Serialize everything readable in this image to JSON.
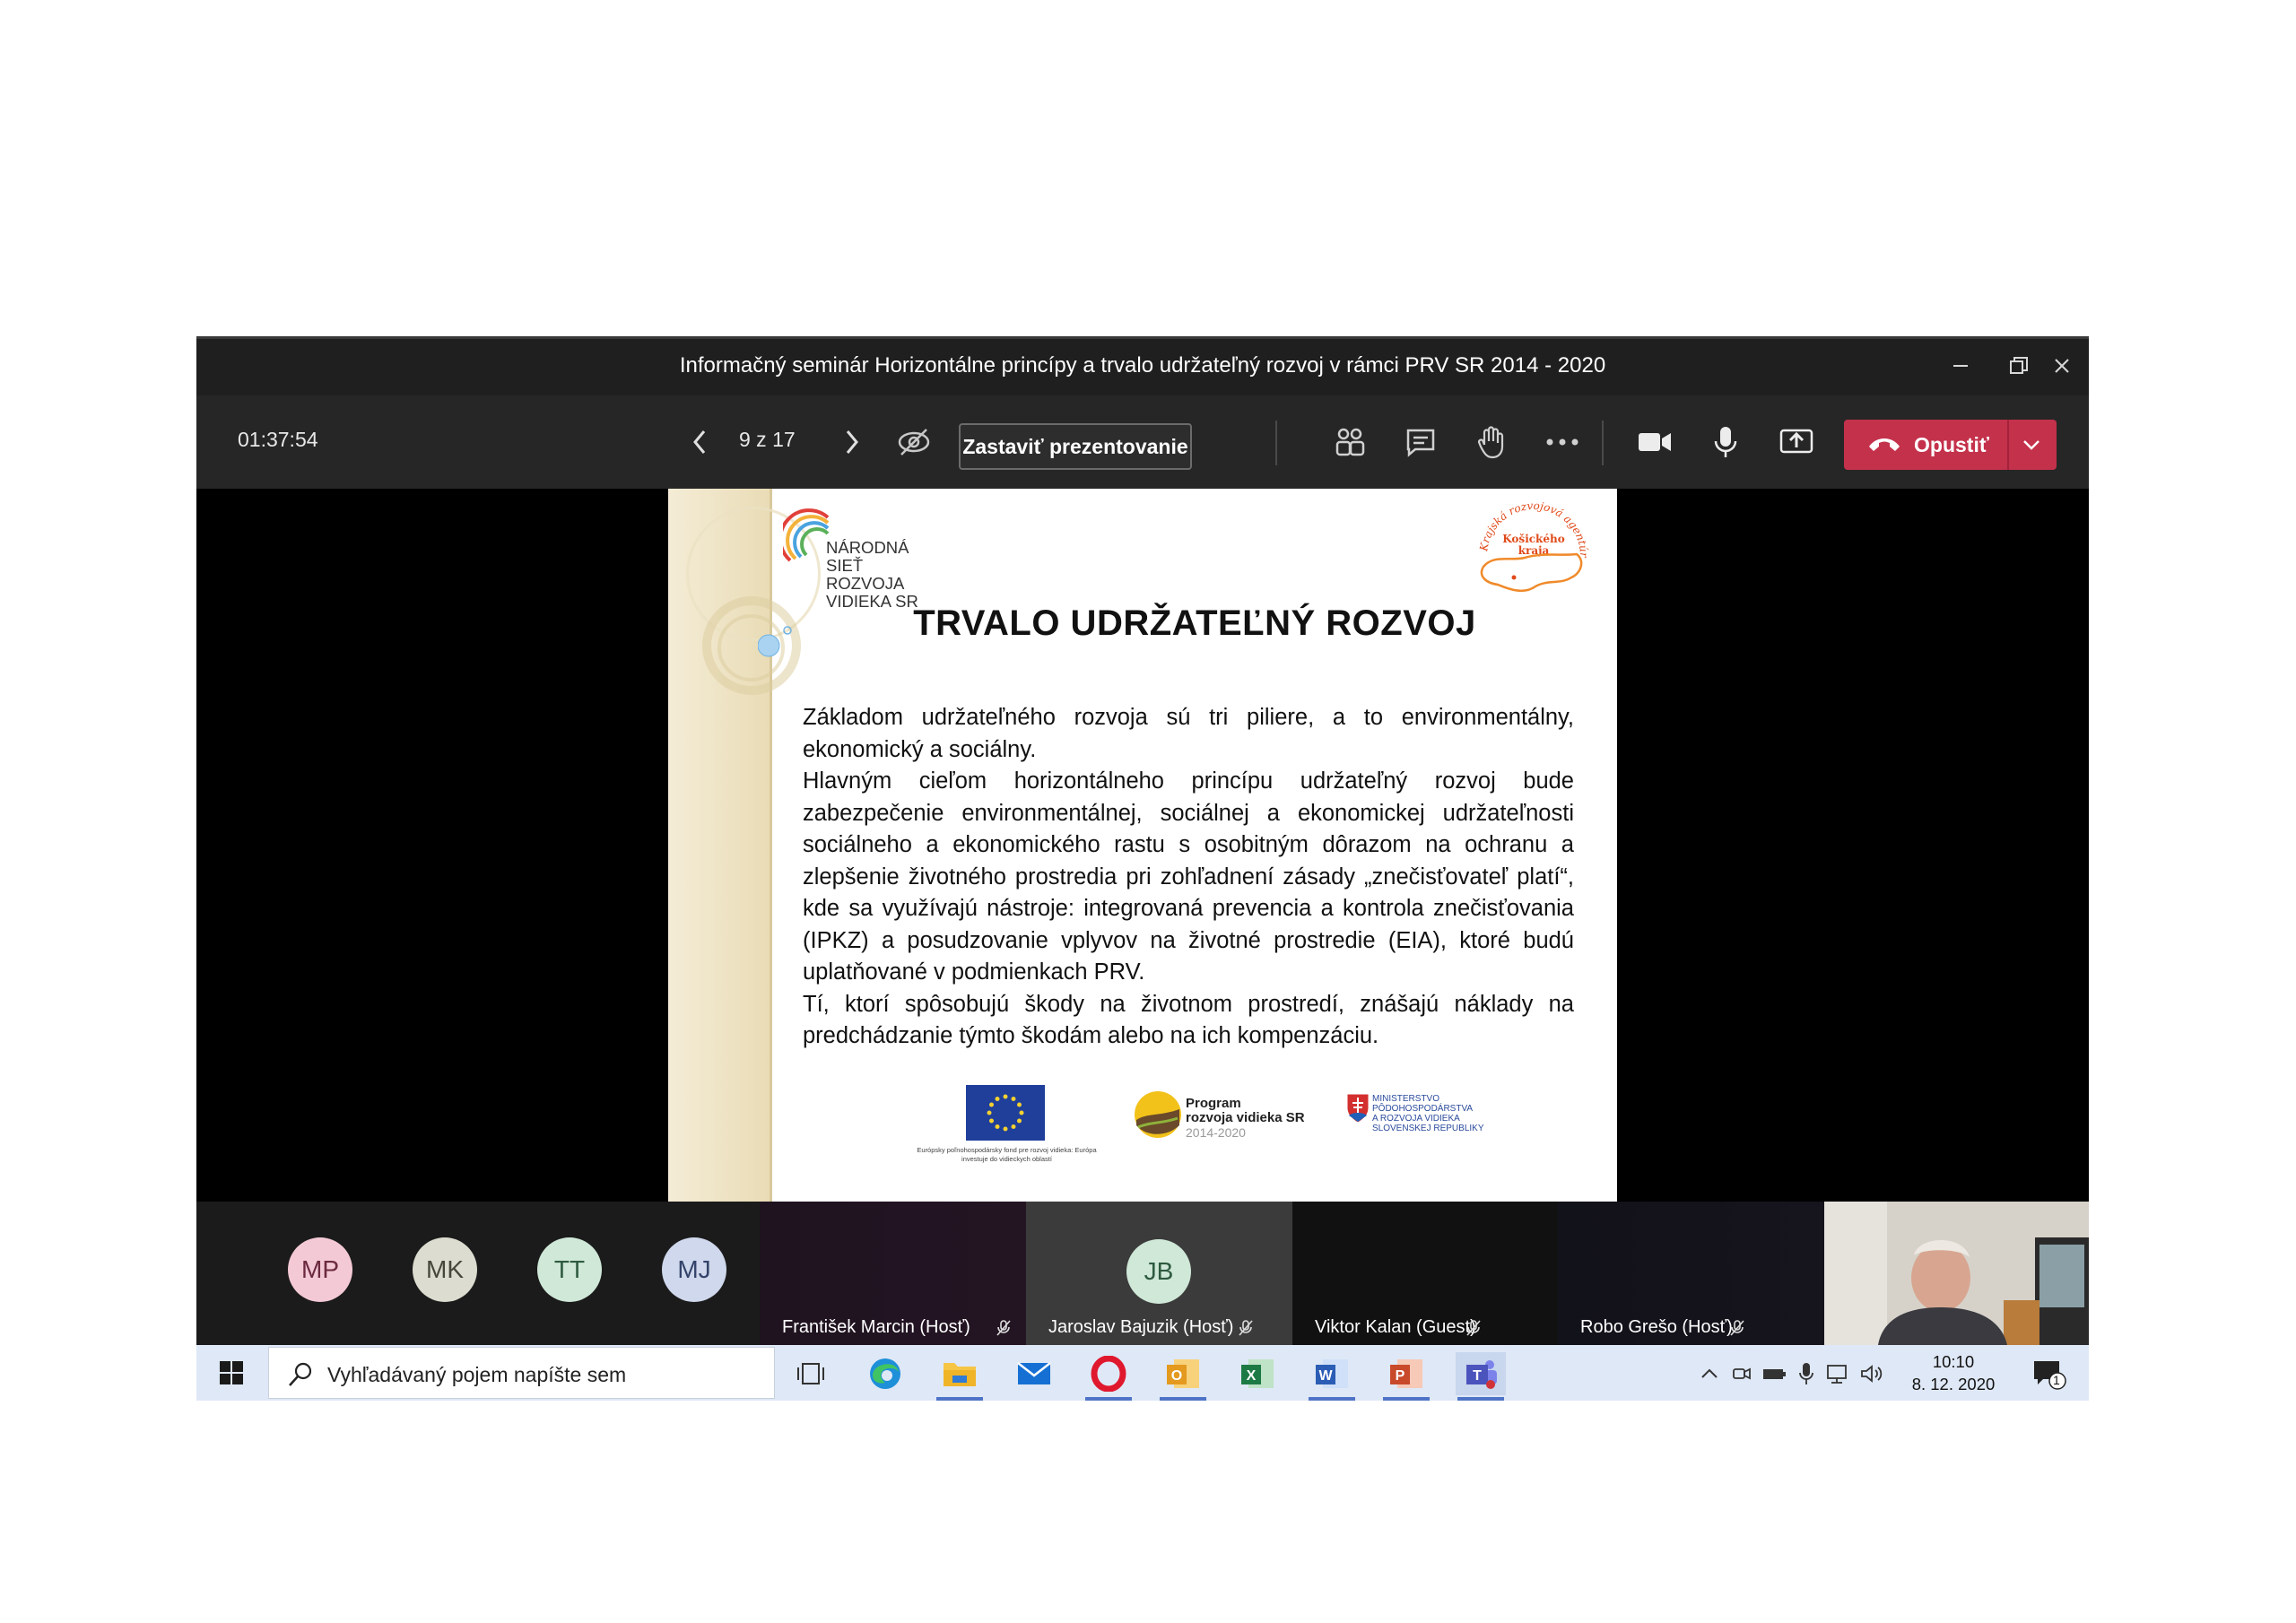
{
  "window": {
    "title": "Informačný seminár Horizontálne princípy a trvalo udržateľný rozvoj v rámci PRV SR 2014 - 2020",
    "controls": [
      "minimize-icon",
      "restore-icon",
      "close-icon"
    ]
  },
  "toolbar": {
    "timer": "01:37:54",
    "page_counter": "9 z 17",
    "stop_presenting_label": "Zastaviť prezentovanie",
    "leave_label": "Opustiť",
    "leave_color": "#c4314b",
    "icons": [
      "chevron-left-icon",
      "chevron-right-icon",
      "eye-slash-icon",
      "participants-icon",
      "chat-icon",
      "raise-hand-icon",
      "more-icon",
      "camera-icon",
      "microphone-icon",
      "share-screen-icon",
      "phone-hangup-icon",
      "chevron-down-icon"
    ]
  },
  "slide": {
    "logo_text": "NÁRODNÁ\nSIEŤ ROZVOJA\nVIDIEKA SR",
    "kraj_logo_text": "Krajská rozvojová agentúra Košického kraja",
    "title": "TRVALO UDRŽATEĽNÝ ROZVOJ",
    "paragraphs": [
      "Základom udržateľného rozvoja sú tri piliere, a to environmentálny, ekonomický a sociálny.",
      "Hlavným cieľom horizontálneho princípu udržateľný rozvoj bude zabezpečenie environmentálnej, sociálnej a ekonomickej udržateľnosti sociálneho a ekonomického rastu s osobitným dôrazom na ochranu a zlepšenie životného prostredia pri zohľadnení zásady „znečisťovateľ platí“, kde sa využívajú nástroje: integrovaná prevencia a kontrola znečisťovania (IPKZ) a posudzovanie vplyvov na životné prostredie (EIA), ktoré budú uplatňované v podmienkach PRV.",
      "Tí, ktorí spôsobujú škody na životnom prostredí, znášajú náklady na predchádzanie týmto škodám alebo na ich kompenzáciu."
    ],
    "eu_caption": "Európsky poľnohospodársky fond pre rozvoj vidieka: Európa investuje do vidieckych oblastí",
    "prv_label": "Program\nrozvoja vidieka SR",
    "prv_years": "2014-2020",
    "ministry_label": "MINISTERSTVO\nPÔDOHOSPODÁRSTVA\nA ROZVOJA VIDIEKA\nSLOVENSKEJ REPUBLIKY"
  },
  "participants": {
    "avatars": [
      {
        "initials": "MP",
        "bg": "#f4c9d6",
        "fg": "#6b2a3f"
      },
      {
        "initials": "MK",
        "bg": "#dcdcd0",
        "fg": "#45473a"
      },
      {
        "initials": "TT",
        "bg": "#cfe8d8",
        "fg": "#2e5a3f"
      },
      {
        "initials": "MJ",
        "bg": "#cfd8ec",
        "fg": "#34436a"
      }
    ],
    "tiles": [
      {
        "name": "František Marcin (Hosť)"
      },
      {
        "name": "Jaroslav Bajuzik (Hosť)",
        "initials": "JB"
      },
      {
        "name": "Viktor Kalan (Guest)"
      },
      {
        "name": "Robo Grešo (Hosť)"
      }
    ]
  },
  "taskbar": {
    "search_placeholder": "Vyhľadávaný pojem napíšte sem",
    "apps": [
      "task-view-icon",
      "edge-icon",
      "file-explorer-icon",
      "mail-icon",
      "opera-icon",
      "outlook-icon",
      "excel-icon",
      "word-icon",
      "powerpoint-icon",
      "teams-icon"
    ],
    "time": "10:10",
    "date": "8. 12. 2020",
    "notification_count": "1"
  }
}
